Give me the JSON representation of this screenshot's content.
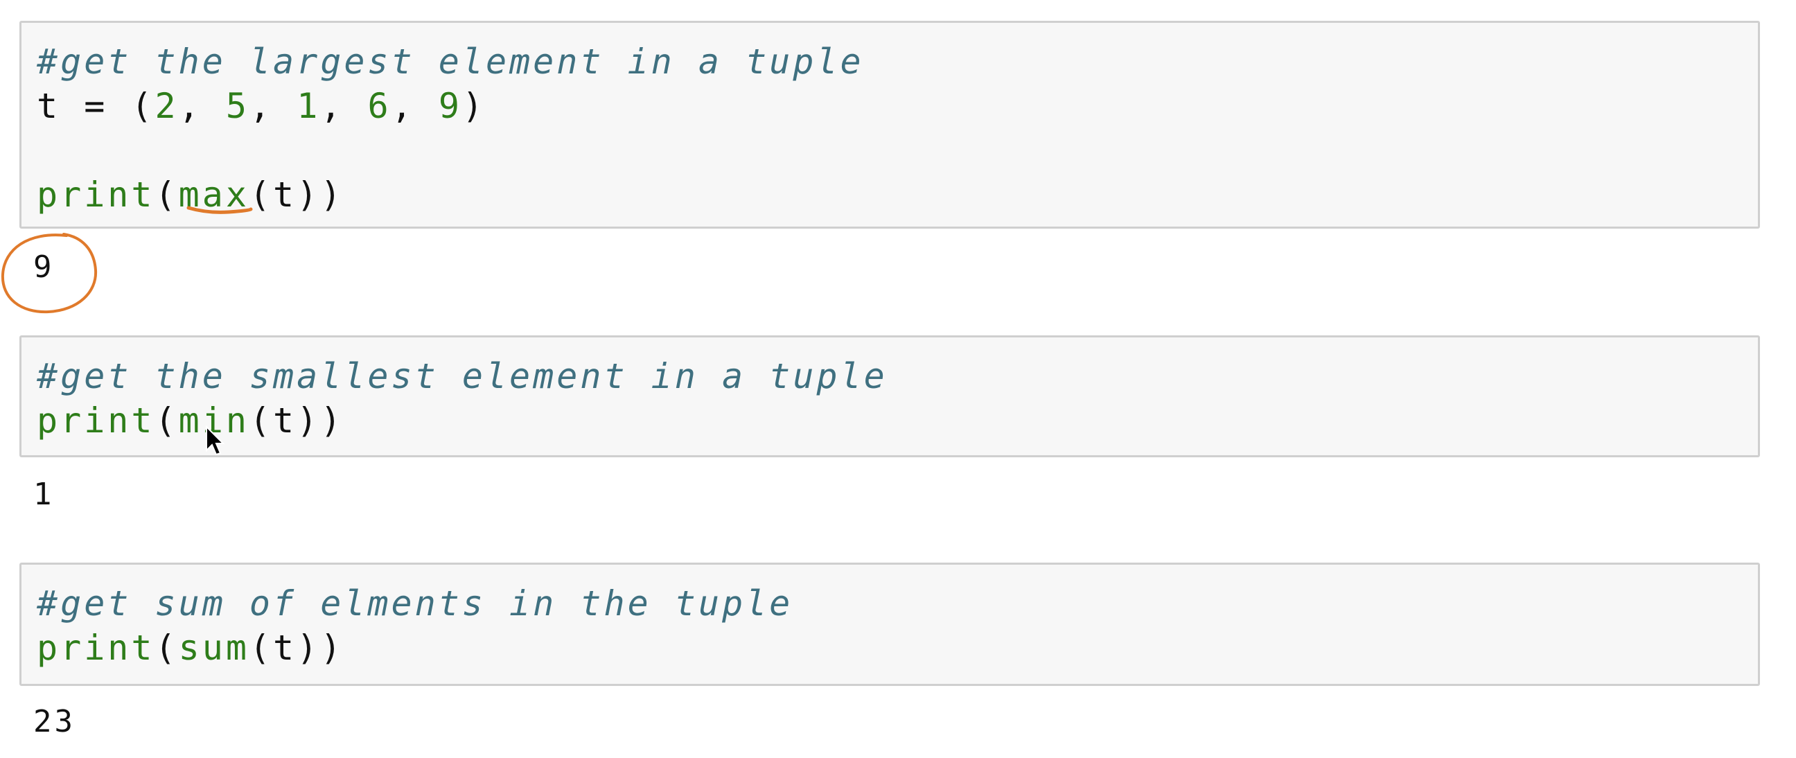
{
  "annotation_color": "#e07a2b",
  "cells": [
    {
      "comment": "#get the largest element in a tuple",
      "assign": {
        "var": "t",
        "op": " = ",
        "open": "(",
        "n1": "2",
        "sep1": ", ",
        "n2": "5",
        "sep2": ", ",
        "n3": "1",
        "sep3": ", ",
        "n4": "6",
        "sep4": ", ",
        "n5": "9",
        "close": ")"
      },
      "call": {
        "fn": "print",
        "open": "(",
        "inner": "max",
        "args": "(t))"
      },
      "output": "9"
    },
    {
      "comment": "#get the smallest element in a tuple",
      "call": {
        "fn": "print",
        "open": "(",
        "inner": "min",
        "args": "(t))"
      },
      "output": "1"
    },
    {
      "comment": "#get sum of elments in the tuple",
      "call": {
        "fn": "print",
        "open": "(",
        "inner": "sum",
        "args": "(t))"
      },
      "output": "23"
    }
  ]
}
